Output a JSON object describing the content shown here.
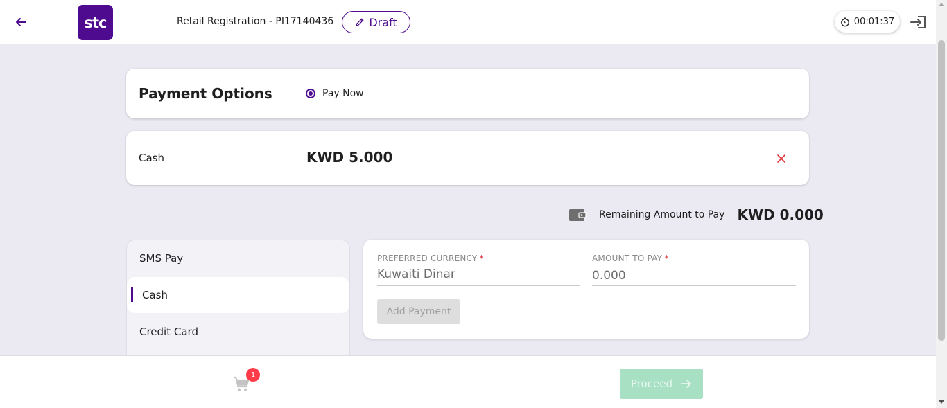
{
  "header": {
    "title": "Retail Registration - PI17140436",
    "draft_label": "Draft",
    "logo_text": "stc",
    "timer": "00:01:37"
  },
  "payment_options": {
    "title": "Payment Options",
    "option_label": "Pay Now",
    "option_selected": true
  },
  "selected_payment": {
    "method": "Cash",
    "amount": "KWD 5.000"
  },
  "remaining": {
    "label": "Remaining Amount to Pay",
    "amount": "KWD 0.000"
  },
  "methods": [
    {
      "label": "SMS Pay",
      "active": false
    },
    {
      "label": "Cash",
      "active": true
    },
    {
      "label": "Credit Card",
      "active": false
    }
  ],
  "form": {
    "currency_label": "PREFERRED CURRENCY",
    "currency_value": "Kuwaiti Dinar",
    "amount_label": "AMOUNT TO PAY",
    "amount_value": "0.000",
    "required_mark": "*",
    "add_button": "Add Payment"
  },
  "footer": {
    "cart_count": "1",
    "proceed_label": "Proceed"
  },
  "colors": {
    "brand": "#4f0b8f",
    "danger": "#e0303a",
    "proceed_disabled": "#a8e0c4"
  }
}
